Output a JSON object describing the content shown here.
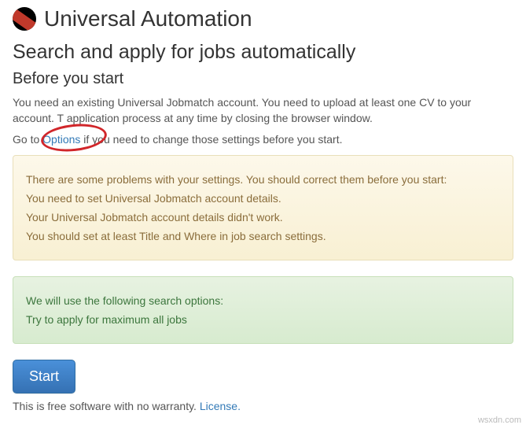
{
  "header": {
    "app_title": "Universal Automation",
    "subtitle": "Search and apply for jobs automatically",
    "section": "Before you start"
  },
  "intro": {
    "p1": "You need an existing Universal Jobmatch account. You need to upload at least one CV to your account. T application process at any time by closing the browser window.",
    "p2_pre": "Go to ",
    "p2_link": "Options",
    "p2_post": " if you need to change those settings before you start."
  },
  "warning_panel": {
    "l1": "There are some problems with your settings. You should correct them before you start:",
    "l2": "You need to set Universal Jobmatch account details.",
    "l3": "Your Universal Jobmatch account details didn't work.",
    "l4": "You should set at least Title and Where in job search settings."
  },
  "info_panel": {
    "l1": "We will use the following search options:",
    "l2": "Try to apply for maximum all jobs"
  },
  "actions": {
    "start_label": "Start"
  },
  "footer": {
    "text": "This is free software with no warranty. ",
    "license_label": "License.",
    "watermark": "wsxdn.com"
  }
}
